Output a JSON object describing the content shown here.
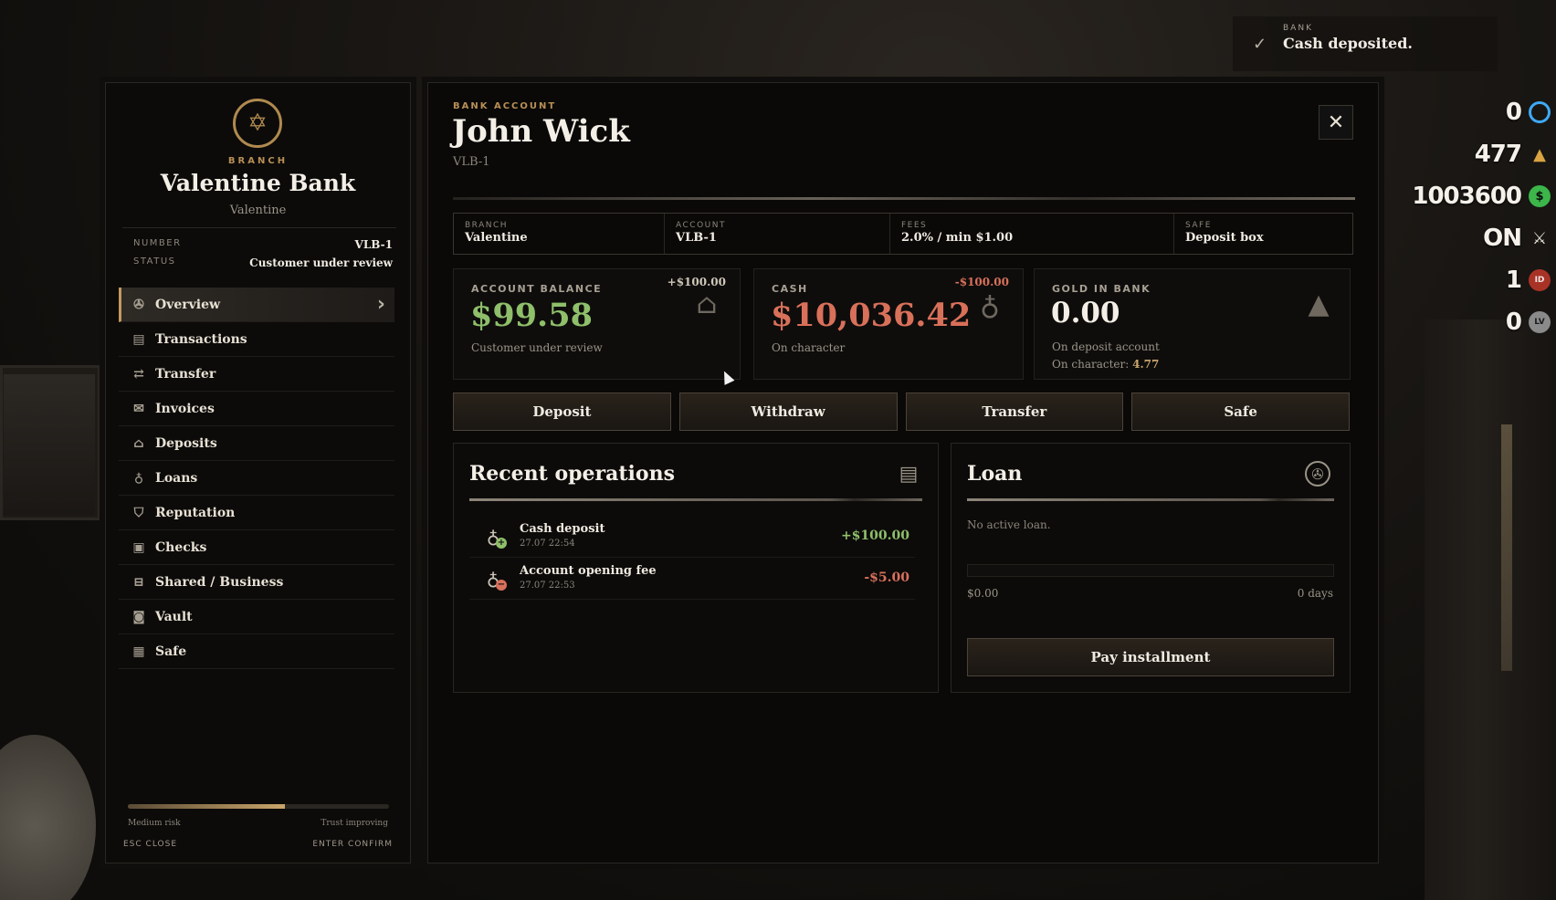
{
  "notification": {
    "kicker": "BANK",
    "message": "Cash deposited."
  },
  "hud": [
    {
      "value": "0",
      "icon": "ring-icon",
      "color": "#3fa9f5"
    },
    {
      "value": "477",
      "icon": "gold-bars-icon",
      "color": "#d9a441"
    },
    {
      "value": "1003600",
      "icon": "dollar-icon",
      "color": "#3cb54a"
    },
    {
      "value": "ON",
      "icon": "pistols-icon",
      "color": "#e8e1d4"
    },
    {
      "value": "1",
      "icon": "id-icon",
      "color": "#c0392b"
    },
    {
      "value": "0",
      "icon": "lv-icon",
      "color": "#9a9a9a"
    }
  ],
  "sidebar": {
    "branch_kicker": "BRANCH",
    "bank_name": "Valentine Bank",
    "bank_city": "Valentine",
    "number_label": "NUMBER",
    "number_value": "VLB-1",
    "status_label": "STATUS",
    "status_value": "Customer under review",
    "items": [
      {
        "label": "Overview",
        "icon": "compass-icon"
      },
      {
        "label": "Transactions",
        "icon": "document-icon"
      },
      {
        "label": "Transfer",
        "icon": "transfer-icon"
      },
      {
        "label": "Invoices",
        "icon": "envelope-icon"
      },
      {
        "label": "Deposits",
        "icon": "bank-icon"
      },
      {
        "label": "Loans",
        "icon": "money-bag-icon"
      },
      {
        "label": "Reputation",
        "icon": "shield-icon"
      },
      {
        "label": "Checks",
        "icon": "check-icon"
      },
      {
        "label": "Shared / Business",
        "icon": "briefcase-icon"
      },
      {
        "label": "Vault",
        "icon": "vault-icon"
      },
      {
        "label": "Safe",
        "icon": "safe-icon"
      }
    ],
    "risk_level": 0.6,
    "risk_left": "Medium risk",
    "risk_right": "Trust improving",
    "hint_close": "ESC CLOSE",
    "hint_confirm": "ENTER CONFIRM"
  },
  "account": {
    "kicker": "BANK ACCOUNT",
    "name": "John Wick",
    "number": "VLB-1",
    "close_label": "✕",
    "info": [
      {
        "label": "BRANCH",
        "value": "Valentine"
      },
      {
        "label": "ACCOUNT",
        "value": "VLB-1"
      },
      {
        "label": "FEES",
        "value": "2.0% / min $1.00"
      },
      {
        "label": "SAFE",
        "value": "Deposit box"
      }
    ],
    "balance": {
      "label": "ACCOUNT BALANCE",
      "delta": "+$100.00",
      "value": "$99.58",
      "sub": "Customer under review",
      "color": "#8fbf6a"
    },
    "cash": {
      "label": "CASH",
      "delta": "-$100.00",
      "value": "$10,036.42",
      "sub": "On character",
      "color": "#d9705a"
    },
    "gold": {
      "label": "GOLD IN BANK",
      "value": "0.00",
      "sub": "On deposit account",
      "sub2_label": "On character:",
      "sub2_value": "4.77"
    },
    "actions": [
      "Deposit",
      "Withdraw",
      "Transfer",
      "Safe"
    ]
  },
  "recent": {
    "title": "Recent operations",
    "items": [
      {
        "title": "Cash deposit",
        "time": "27.07 22:54",
        "amount": "+$100.00",
        "sign": "+",
        "color": "#8fbf6a"
      },
      {
        "title": "Account opening fee",
        "time": "27.07 22:53",
        "amount": "-$5.00",
        "sign": "−",
        "color": "#d9705a"
      }
    ]
  },
  "loan": {
    "title": "Loan",
    "status": "No active loan.",
    "amount": "$0.00",
    "days": "0 days",
    "pay_label": "Pay installment"
  }
}
